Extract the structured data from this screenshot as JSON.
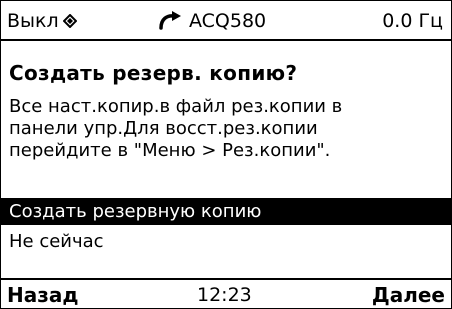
{
  "status_bar": {
    "mode": "Выкл",
    "mode_icon": "control-location-diamond-icon",
    "rotation_icon": "rotation-direction-icon",
    "drive_name": "ACQ580",
    "frequency": "0.0 Гц"
  },
  "dialog": {
    "title": "Создать резерв. копию?",
    "message_lines": [
      "Все наст.копир.в файл рез.копии в",
      "панели упр.Для восст.рез.копии",
      "перейдите в \"Меню > Рез.копии\"."
    ],
    "options": [
      {
        "label": "Создать резервную копию",
        "selected": true
      },
      {
        "label": "Не сейчас",
        "selected": false
      }
    ]
  },
  "footer": {
    "left_softkey": "Назад",
    "time": "12:23",
    "right_softkey": "Далее"
  },
  "colors": {
    "background": "#ffffff",
    "foreground": "#000000",
    "selection_background": "#000000",
    "selection_text": "#ffffff"
  }
}
